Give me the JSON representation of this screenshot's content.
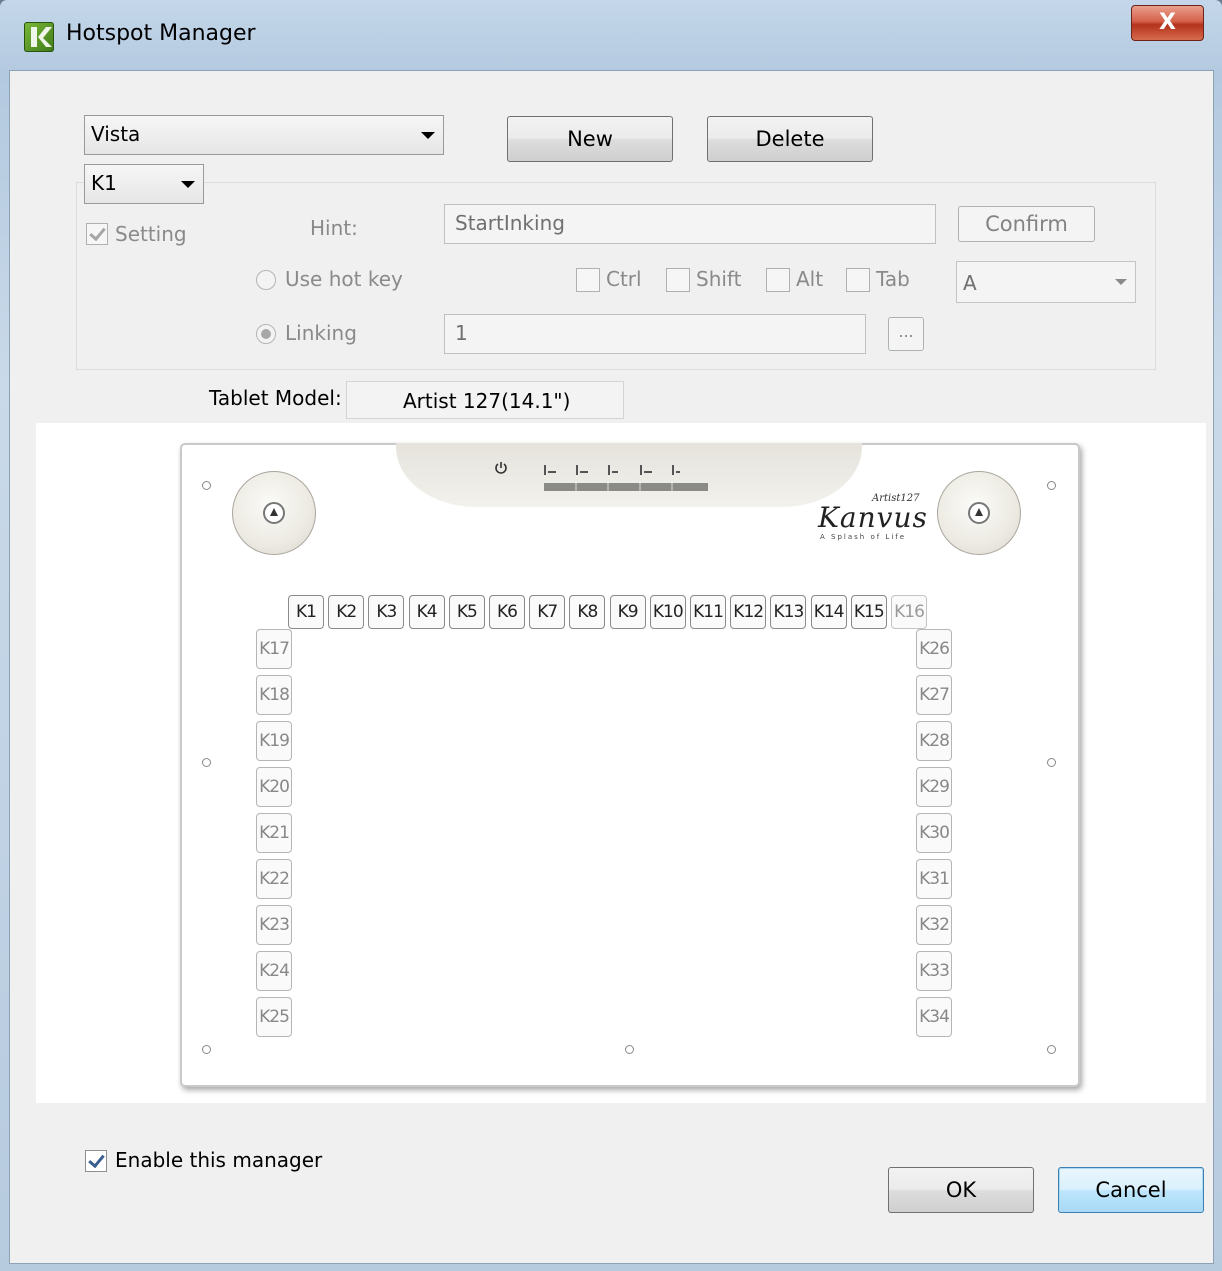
{
  "window": {
    "title": "Hotspot Manager",
    "close_symbol": "X"
  },
  "profile_select": {
    "value": "Vista"
  },
  "key_select": {
    "value": "K1"
  },
  "buttons": {
    "new": "New",
    "delete": "Delete",
    "confirm": "Confirm",
    "browse": "...",
    "ok": "OK",
    "cancel": "Cancel"
  },
  "setting": {
    "label": "Setting",
    "checked": true
  },
  "hint": {
    "label": "Hint:",
    "value": "StartInking"
  },
  "use_hot_key": {
    "label": "Use hot key",
    "selected": false
  },
  "modifiers": {
    "ctrl": "Ctrl",
    "shift": "Shift",
    "alt": "Alt",
    "tab": "Tab"
  },
  "hot_key_select": {
    "value": "A"
  },
  "linking": {
    "label": "Linking",
    "selected": true,
    "value": "1"
  },
  "tablet_model": {
    "label": "Tablet Model:",
    "value": "Artist 127(14.1\")"
  },
  "tablet": {
    "brand": "Kanvus",
    "model_script": "Artist127",
    "tagline": "A Splash of Life",
    "top_keys": [
      "K1",
      "K2",
      "K3",
      "K4",
      "K5",
      "K6",
      "K7",
      "K8",
      "K9",
      "K10",
      "K11",
      "K12",
      "K13",
      "K14",
      "K15",
      "K16"
    ],
    "left_keys": [
      "K17",
      "K18",
      "K19",
      "K20",
      "K21",
      "K22",
      "K23",
      "K24",
      "K25"
    ],
    "right_keys": [
      "K26",
      "K27",
      "K28",
      "K29",
      "K30",
      "K31",
      "K32",
      "K33",
      "K34"
    ]
  },
  "enable_manager": {
    "label": "Enable this manager",
    "checked": true
  },
  "colors": {
    "title_bar": "#c4d7ea",
    "close_button": "#c9452f",
    "dialog_bg": "#f0f0f0",
    "focus_button": "#3c7fb1"
  }
}
